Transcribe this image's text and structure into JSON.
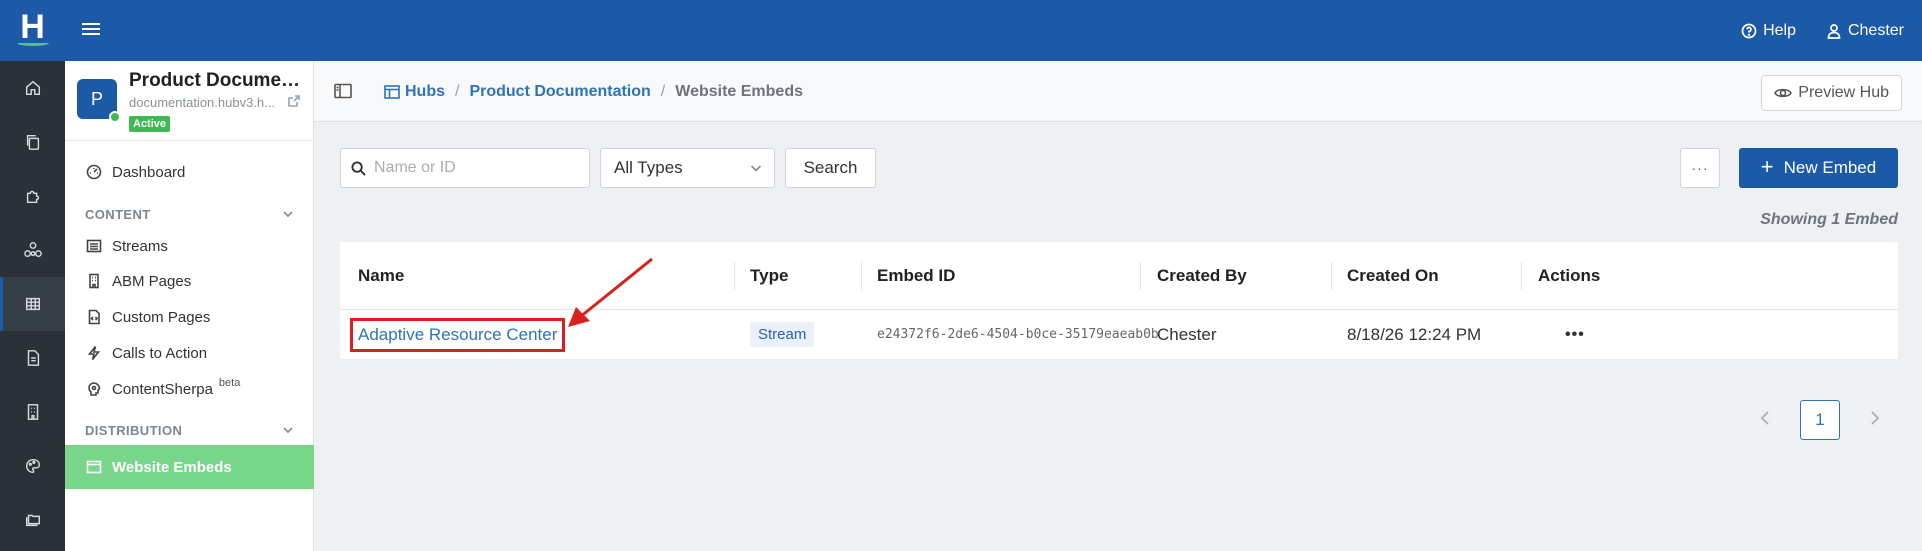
{
  "rail": {
    "logo_letter": "H",
    "icons": [
      "home-icon",
      "copy-icon",
      "puzzle-icon",
      "network-icon",
      "grid-icon",
      "document-icon",
      "building-icon",
      "palette-icon",
      "folders-icon"
    ],
    "active_index": 4
  },
  "topbar": {
    "help_label": "Help",
    "user_label": "Chester"
  },
  "hub": {
    "avatar_letter": "P",
    "title": "Product Documentation",
    "url": "documentation.hubv3.h...",
    "status": "Active"
  },
  "sidebar": {
    "dashboard": "Dashboard",
    "content_section": "CONTENT",
    "streams": "Streams",
    "abm_pages": "ABM Pages",
    "custom_pages": "Custom Pages",
    "calls_to_action": "Calls to Action",
    "contentsherpa": "ContentSherpa",
    "beta": "beta",
    "distribution_section": "DISTRIBUTION",
    "website_embeds": "Website Embeds"
  },
  "breadcrumb": {
    "hubs": "Hubs",
    "hub": "Product Documentation",
    "current": "Website Embeds",
    "separator": "/"
  },
  "toolbar": {
    "preview_label": "Preview Hub",
    "search_placeholder": "Name or ID",
    "type_selected": "All Types",
    "search_label": "Search",
    "more_label": "···",
    "new_label": "New Embed",
    "showing_text": "Showing 1 Embed"
  },
  "table": {
    "columns": [
      "Name",
      "Type",
      "Embed ID",
      "Created By",
      "Created On",
      "Actions"
    ],
    "rows": [
      {
        "name": "Adaptive Resource Center",
        "type": "Stream",
        "embed_id": "e24372f6-2de6-4504-b0ce-35179eaeab0b",
        "created_by": "Chester",
        "created_on": "8/18/26 12:24 PM",
        "actions": "•••"
      }
    ]
  },
  "pagination": {
    "current_page": "1"
  },
  "colors": {
    "brand": "#1c5aa8",
    "active_nav": "#78d68a",
    "annotation": "#d9201f"
  }
}
